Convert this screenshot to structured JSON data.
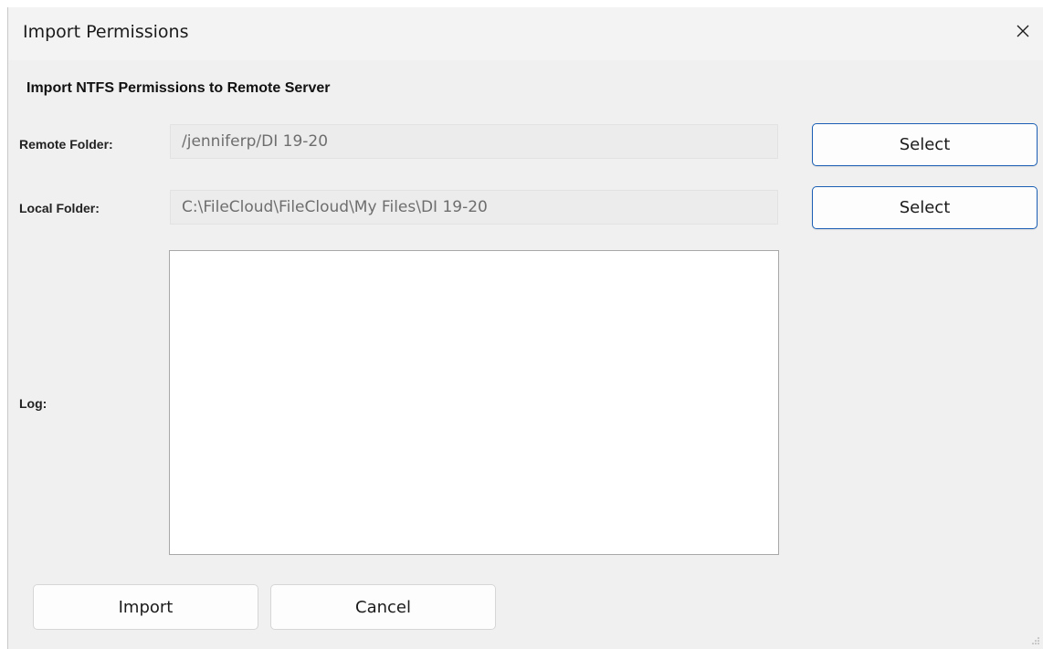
{
  "window": {
    "title": "Import Permissions"
  },
  "dialog": {
    "heading": "Import NTFS Permissions to Remote Server",
    "remote_folder": {
      "label": "Remote Folder:",
      "value": "/jenniferp/DI 19-20",
      "button_label": "Select"
    },
    "local_folder": {
      "label": "Local Folder:",
      "value": "C:\\FileCloud\\FileCloud\\My Files\\DI 19-20",
      "button_label": "Select"
    },
    "log": {
      "label": "Log:",
      "content": ""
    },
    "actions": {
      "import_label": "Import",
      "cancel_label": "Cancel"
    }
  },
  "icons": {
    "close": "close-icon",
    "resize": "resize-grip-icon"
  },
  "colors": {
    "accent": "#1a5fb4",
    "window_bg": "#f0f0f0",
    "field_bg": "#ececec",
    "field_text": "#6e6e6e"
  }
}
